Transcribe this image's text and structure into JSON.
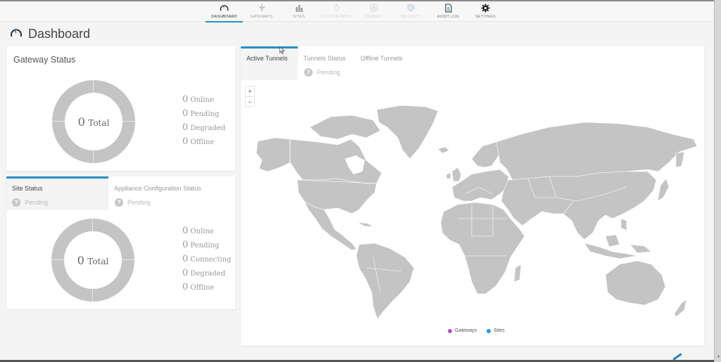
{
  "nav": {
    "items": [
      {
        "label": "DASHBOARD",
        "icon": "speedometer-icon",
        "state": "active"
      },
      {
        "label": "GATEWAYS",
        "icon": "usb-icon",
        "state": "normal"
      },
      {
        "label": "SITES",
        "icon": "buildings-icon",
        "state": "normal"
      },
      {
        "label": "CUSTOM APPS",
        "icon": "app-icon",
        "state": "disabled"
      },
      {
        "label": "DOMAIN",
        "icon": "network-icon",
        "state": "disabled"
      },
      {
        "label": "SECURITY",
        "icon": "shield-icon",
        "state": "disabled"
      },
      {
        "label": "AUDIT LOG",
        "icon": "document-icon",
        "state": "dark"
      },
      {
        "label": "SETTINGS",
        "icon": "gear-icon",
        "state": "dark"
      }
    ]
  },
  "page": {
    "title": "Dashboard"
  },
  "gateway_status": {
    "title": "Gateway Status",
    "total_count": "0",
    "total_label": "Total",
    "legend": [
      {
        "count": "0",
        "label": "Online"
      },
      {
        "count": "0",
        "label": "Pending"
      },
      {
        "count": "0",
        "label": "Degraded"
      },
      {
        "count": "0",
        "label": "Offline"
      }
    ]
  },
  "site_status": {
    "tabs": [
      {
        "label": "Site Status",
        "active": true,
        "pending": "Pending"
      },
      {
        "label": "Appliance Configuration Status",
        "active": false,
        "pending": "Pending"
      }
    ],
    "total_count": "0",
    "total_label": "Total",
    "legend": [
      {
        "count": "0",
        "label": "Online"
      },
      {
        "count": "0",
        "label": "Pending"
      },
      {
        "count": "0",
        "label": "Connecting"
      },
      {
        "count": "0",
        "label": "Degraded"
      },
      {
        "count": "0",
        "label": "Offline"
      }
    ]
  },
  "tunnels": {
    "tabs": [
      {
        "label": "Active Tunnels",
        "active": true
      },
      {
        "label": "Tunnels Status",
        "active": false
      },
      {
        "label": "Offline Tunnels",
        "active": false
      }
    ],
    "pending": "Pending",
    "zoom_in": "+",
    "zoom_out": "−",
    "legend": [
      {
        "label": "Gateways",
        "color": "#b24fc4"
      },
      {
        "label": "Sites",
        "color": "#2a9bd4"
      }
    ]
  },
  "colors": {
    "accent": "#2a8fc4",
    "land": "#c4c4c4"
  }
}
